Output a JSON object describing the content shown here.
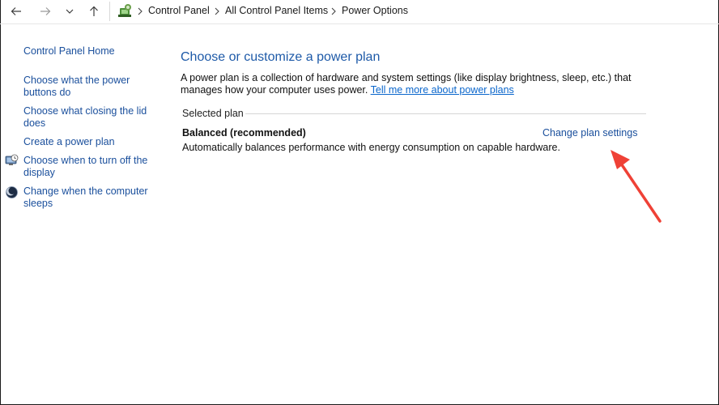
{
  "breadcrumb": {
    "items": [
      "Control Panel",
      "All Control Panel Items",
      "Power Options"
    ]
  },
  "sidebar": {
    "home": "Control Panel Home",
    "items": [
      {
        "label": "Choose what the power buttons do",
        "icon": ""
      },
      {
        "label": "Choose what closing the lid does",
        "icon": ""
      },
      {
        "label": "Create a power plan",
        "icon": ""
      },
      {
        "label": "Choose when to turn off the display",
        "icon": "display-clock-icon"
      },
      {
        "label": "Change when the computer sleeps",
        "icon": "moon-icon"
      }
    ]
  },
  "main": {
    "title": "Choose or customize a power plan",
    "description": "A power plan is a collection of hardware and system settings (like display brightness, sleep, etc.) that manages how your computer uses power.",
    "learn_more_link": "Tell me more about power plans",
    "section_label": "Selected plan",
    "plan": {
      "name": "Balanced (recommended)",
      "description": "Automatically balances performance with energy consumption on capable hardware.",
      "change_link": "Change plan settings"
    }
  },
  "colors": {
    "link": "#1a4f9c",
    "title": "#1e5aa8",
    "annotation_arrow": "#ef4136"
  }
}
